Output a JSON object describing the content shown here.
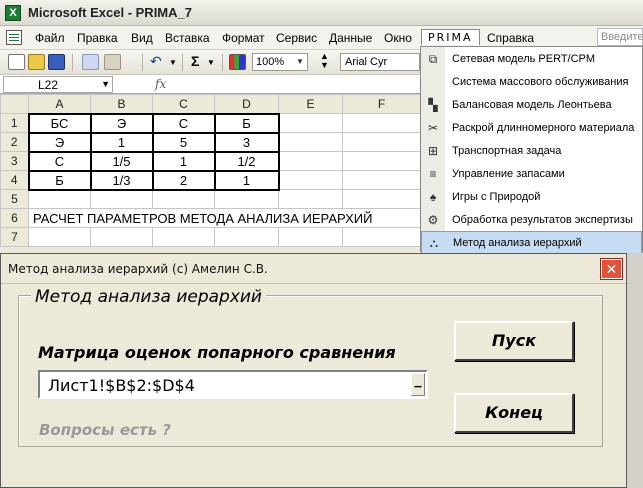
{
  "titlebar": {
    "title": "Microsoft Excel - PRIMA_7",
    "icon": "X"
  },
  "menubar": {
    "items": [
      "Файл",
      "Правка",
      "Вид",
      "Вставка",
      "Формат",
      "Сервис",
      "Данные",
      "Окно",
      "PRIMA",
      "Справка"
    ],
    "help_placeholder": "Введите"
  },
  "toolbar": {
    "zoom": "100%",
    "font": "Arial Cyr",
    "sum": "Σ"
  },
  "formulabar": {
    "cell_ref": "L22",
    "fx": "fx"
  },
  "sheet": {
    "columns": [
      "A",
      "B",
      "C",
      "D",
      "E",
      "F"
    ],
    "rows": [
      {
        "n": "1",
        "cells": [
          "БС",
          "Э",
          "С",
          "Б",
          "",
          ""
        ]
      },
      {
        "n": "2",
        "cells": [
          "Э",
          "1",
          "5",
          "3",
          "",
          ""
        ]
      },
      {
        "n": "3",
        "cells": [
          "С",
          "1/5",
          "1",
          "1/2",
          "",
          ""
        ]
      },
      {
        "n": "4",
        "cells": [
          "Б",
          "1/3",
          "2",
          "1",
          "",
          ""
        ]
      },
      {
        "n": "5",
        "cells": [
          "",
          "",
          "",
          "",
          "",
          ""
        ]
      },
      {
        "n": "6",
        "cells": [
          "РАСЧЕТ ПАРАМЕТРОВ МЕТОДА АНАЛИЗА ИЕРАРХИЙ",
          "",
          "",
          "",
          "",
          ""
        ]
      },
      {
        "n": "7",
        "cells": [
          "",
          "",
          "",
          "",
          "",
          ""
        ]
      }
    ]
  },
  "prima_menu": {
    "items": [
      {
        "label": "Сетевая модель PERT/CPM",
        "icon": "network-icon"
      },
      {
        "label": "Система массового обслуживания",
        "icon": "queue-icon"
      },
      {
        "label": "Балансовая модель Леонтьева",
        "icon": "balance-icon"
      },
      {
        "label": "Раскрой длинномерного материала",
        "icon": "scissors-icon"
      },
      {
        "label": "Транспортная задача",
        "icon": "transport-icon"
      },
      {
        "label": "Управление запасами",
        "icon": "inventory-icon"
      },
      {
        "label": "Игры с Природой",
        "icon": "spade-icon"
      },
      {
        "label": "Обработка результатов экспертизы",
        "icon": "expert-icon"
      },
      {
        "label": "Метод анализа иерархий",
        "icon": "hierarchy-icon",
        "selected": true
      }
    ]
  },
  "dialog": {
    "title": "Метод анализа иерархий  (с) Амелин С.В.",
    "frame_title": "Метод анализа иерархий",
    "matrix_label": "Матрица оценок попарного сравнения",
    "range_value": "Лист1!$B$2:$D$4",
    "questions": "Вопросы есть ?",
    "run_button": "Пуск",
    "close_button": "Конец"
  }
}
